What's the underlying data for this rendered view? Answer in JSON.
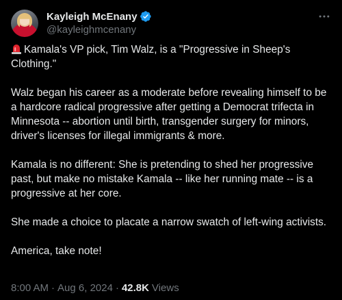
{
  "author": {
    "display_name": "Kayleigh McEnany",
    "handle": "@kayleighmcenany",
    "verified": true,
    "avatar_icon": "profile-photo"
  },
  "tweet": {
    "paragraphs": [
      "Kamala's VP pick, Tim Walz, is a \"Progressive in Sheep's Clothing.\"",
      "Walz began his career as a moderate before revealing himself to be a hardcore radical progressive after getting a Democrat trifecta in Minnesota -- abortion until birth, transgender surgery for minors, driver's licenses for illegal immigrants & more.",
      "Kamala is no different: She is pretending to shed her progressive past, but make no mistake Kamala -- like her running mate -- is a progressive at her core.",
      "She made a choice to placate a narrow swatch of left-wing activists.",
      "America, take note!"
    ],
    "lead_icon": "siren-emoji"
  },
  "meta": {
    "time": "8:00 AM",
    "date": "Aug 6, 2024",
    "views_count": "42.8K",
    "views_label": "Views",
    "separator": "·"
  },
  "colors": {
    "background": "#000000",
    "text": "#e7e9ea",
    "secondary": "#71767b",
    "verified_badge": "#1d9bf0"
  }
}
